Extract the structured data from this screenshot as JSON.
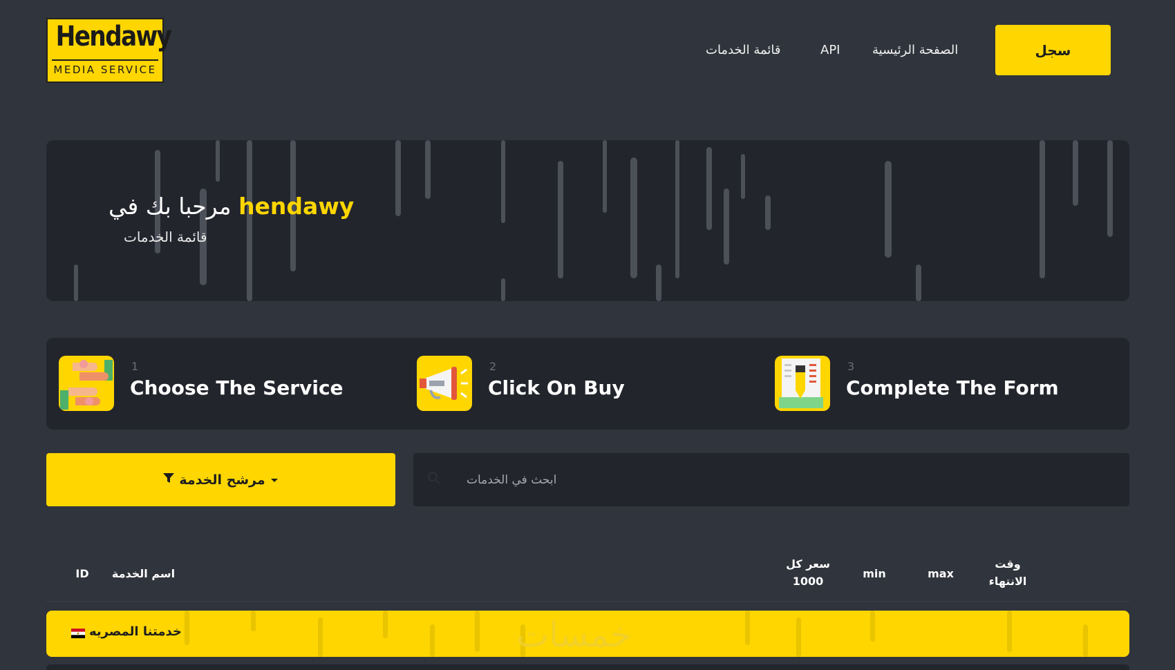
{
  "header": {
    "logo": {
      "word": "Hendawy",
      "subtitle": "MEDIA SERVICE"
    },
    "nav": [
      {
        "label": "قائمة الخدمات"
      },
      {
        "label": "API"
      },
      {
        "label": "الصفحة الرئيسية"
      }
    ],
    "signup_label": "سجل"
  },
  "hero": {
    "brand": "hendawy",
    "welcome": "مرحبا بك في",
    "subtitle": "قائمة الخدمات"
  },
  "steps": [
    {
      "number": "1",
      "label": "Choose The Service",
      "icon": "handshake-icon"
    },
    {
      "number": "2",
      "label": "Click On Buy",
      "icon": "megaphone-icon"
    },
    {
      "number": "3",
      "label": "Complete The Form",
      "icon": "form-icon"
    }
  ],
  "filter": {
    "label": "مرشح الخدمة"
  },
  "search": {
    "placeholder": "ابحث في الخدمات"
  },
  "table": {
    "headers": {
      "id": "ID",
      "name": "اسم الخدمة",
      "price_line1": "سعر كل",
      "price_line2": "1000",
      "min": "min",
      "max": "max",
      "time_line1": "وقت",
      "time_line2": "الانتهاء"
    },
    "category": {
      "label": "خدمتنا المصريه",
      "watermark": "خمسات"
    }
  },
  "colors": {
    "accent": "#ffd600",
    "background": "#30343c",
    "panel": "#23252d"
  }
}
